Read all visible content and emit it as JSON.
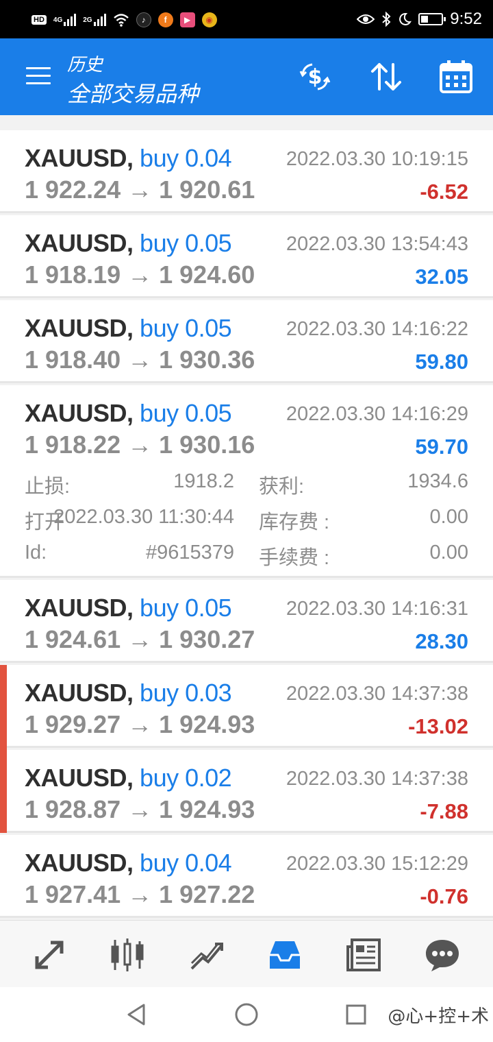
{
  "status_bar": {
    "hd_label": "HD",
    "net1_label": "4G",
    "net2_label": "2G",
    "time": "9:52",
    "icons": [
      "hd-icon",
      "signal-4g-icon",
      "signal-2g-icon",
      "wifi-icon",
      "tiktok-icon",
      "app-f-icon",
      "video-app-icon",
      "weibo-icon",
      "eye-icon",
      "bluetooth-icon",
      "moon-icon",
      "battery-icon"
    ],
    "battery_level": 0.3
  },
  "app_bar": {
    "subtitle": "历史",
    "title": "全部交易品种",
    "icons": [
      "menu-icon",
      "dollar-refresh-icon",
      "sort-icon",
      "calendar-icon"
    ],
    "background": "#1a7ee8"
  },
  "trades": [
    {
      "symbol": "XAUUSD,",
      "side": "buy 0.04",
      "time": "2022.03.30 10:19:15",
      "prices": "1 922.24 → 1 920.61",
      "profit": "-6.52",
      "profit_sign": "neg",
      "marked": false
    },
    {
      "symbol": "XAUUSD,",
      "side": "buy 0.05",
      "time": "2022.03.30 13:54:43",
      "prices": "1 918.19 → 1 924.60",
      "profit": "32.05",
      "profit_sign": "pos",
      "marked": false
    },
    {
      "symbol": "XAUUSD,",
      "side": "buy 0.05",
      "time": "2022.03.30 14:16:22",
      "prices": "1 918.40 → 1 930.36",
      "profit": "59.80",
      "profit_sign": "pos",
      "marked": false
    },
    {
      "symbol": "XAUUSD,",
      "side": "buy 0.05",
      "time": "2022.03.30 14:16:29",
      "prices": "1 918.22 → 1 930.16",
      "profit": "59.70",
      "profit_sign": "pos",
      "marked": false,
      "expanded": true
    },
    {
      "symbol": "XAUUSD,",
      "side": "buy 0.05",
      "time": "2022.03.30 14:16:31",
      "prices": "1 924.61 → 1 930.27",
      "profit": "28.30",
      "profit_sign": "pos",
      "marked": false
    },
    {
      "symbol": "XAUUSD,",
      "side": "buy 0.03",
      "time": "2022.03.30 14:37:38",
      "prices": "1 929.27 → 1 924.93",
      "profit": "-13.02",
      "profit_sign": "neg",
      "marked": true
    },
    {
      "symbol": "XAUUSD,",
      "side": "buy 0.02",
      "time": "2022.03.30 14:37:38",
      "prices": "1 928.87 → 1 924.93",
      "profit": "-7.88",
      "profit_sign": "neg",
      "marked": true
    },
    {
      "symbol": "XAUUSD,",
      "side": "buy 0.04",
      "time": "2022.03.30 15:12:29",
      "prices": "1 927.41 → 1 927.22",
      "profit": "-0.76",
      "profit_sign": "neg",
      "marked": false
    }
  ],
  "details": {
    "sl_label": "止损:",
    "sl_value": "1918.2",
    "tp_label": "获利:",
    "tp_value": "1934.6",
    "open_label": "打开",
    "open_value": "2022.03.30 11:30:44",
    "swap_label": "库存费 :",
    "swap_value": "0.00",
    "id_label": "Id:",
    "id_value": "#9615379",
    "commission_label": "手续费 :",
    "commission_value": "0.00"
  },
  "bottom_nav": {
    "items": [
      "quotes-icon",
      "chart-icon",
      "trade-icon",
      "history-icon",
      "news-icon",
      "chat-icon"
    ],
    "active": "history-icon",
    "active_color": "#1a7ee8",
    "inactive_color": "#555555"
  },
  "system_nav": {
    "icons": [
      "back-icon",
      "home-icon",
      "recents-icon"
    ],
    "watermark": "@心+控+术"
  },
  "colors": {
    "positive": "#1a7ee8",
    "negative": "#d0312d",
    "marker": "#e2533f"
  }
}
